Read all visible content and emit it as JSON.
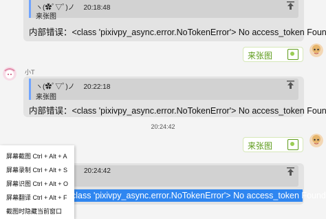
{
  "messages": [
    {
      "quote_face": "ヽ(✿ﾟ▽ﾟ)ノ",
      "quote_time": "20:18:48",
      "quote_text": "来张图",
      "text": "内部错误：<class 'pixivpy_async.error.NoTokenError'> No access_token Found!"
    },
    {
      "sender": "小T",
      "quote_face": "ヽ(✿ﾟ▽ﾟ)ノ",
      "quote_time": "20:22:18",
      "quote_text": "来张图",
      "text": "内部错误：<class 'pixivpy_async.error.NoTokenError'> No access_token Found!"
    },
    {
      "quote_time": "20:24:42",
      "text_partial": "class 'pixivpy_async.error.NoTokenError'> No access_token Found!"
    }
  ],
  "outgoing": [
    {
      "text": "来张图"
    },
    {
      "text": "来张图"
    }
  ],
  "timestamp": "20:24:42",
  "context_menu": {
    "items": [
      "屏幕截图 Ctrl + Alt + A",
      "屏幕录制 Ctrl + Alt + S",
      "屏幕识图 Ctrl + Alt + O",
      "屏幕翻译 Ctrl + Alt + F",
      "截图时隐藏当前窗口"
    ]
  },
  "colors": {
    "bubble": "#e3e3e3",
    "quote": "#d2d2d2",
    "quote_bar": "#6fa4ff",
    "sticker_text": "#5c9a18",
    "selection": "#2f86f0"
  }
}
